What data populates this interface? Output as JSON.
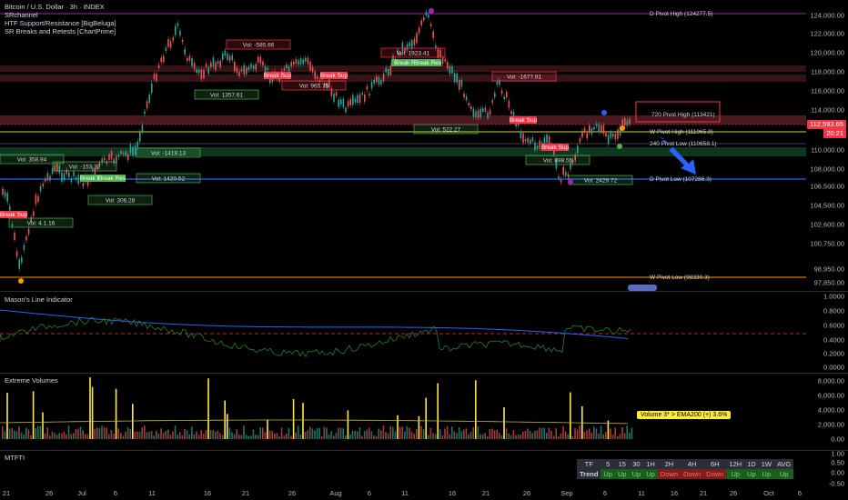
{
  "legend": {
    "title": "Bitcoin / U.S. Dollar · 3h · INDEX",
    "ind1": "SRchannel",
    "ind2": "HTF Support/Resistance [BigBeluga]",
    "ind3": "SR Breaks and Retests [ChartPrime]"
  },
  "price_axis": [
    "124,000.00",
    "122,000.00",
    "120,000.00",
    "118,000.00",
    "116,000.00",
    "114,000.00",
    "110,000.00",
    "108,000.00",
    "106,500.00",
    "104,500.00",
    "102,600.00",
    "100,750.00",
    "98,950.00",
    "97,850.00"
  ],
  "current_price": "112,593.65",
  "countdown": "20:21",
  "price_badge_color": "#f23645",
  "pivots": {
    "d_high": "D Pivot High (124277.5)",
    "p720_high": "720 Pivot High (113421)",
    "w_high": "W Pivot High (111965.8)",
    "p240_low": "240 Pivot Low (110658.1)",
    "d_low": "D Pivot Low (107286.3)",
    "w_low": "W Pivot Low (98330.3)"
  },
  "vol_labels": [
    "Vol: -585.66",
    "Vol: 1923.41",
    "Vol: -1677.91",
    "Vol: 1357.61",
    "Vol: 965.75",
    "Vol: 522.27",
    "Vol: -1419.13",
    "Vol: 358.94",
    "Vol: -153.22",
    "Vol: 1420.52",
    "Vol: 306.28",
    "Vol: 4.1.16",
    "Vol: 898.55",
    "Vol: 2429.72"
  ],
  "break_labels": [
    "Break Sup",
    "Break R",
    "Break Res",
    "Break Sup",
    "Break Sup",
    "Break Sup",
    "Break Res",
    "Break Res",
    "Break Sup"
  ],
  "mason": {
    "title": "Mason's Line Indicator",
    "axis": [
      "1.0000",
      "0.8000",
      "0.6000",
      "0.4000",
      "0.2000",
      "0.0000"
    ]
  },
  "volume": {
    "title": "Extreme Volumes",
    "axis": [
      "8,000.00",
      "6,000.00",
      "4,000.00",
      "2,000.00",
      "0.00"
    ],
    "note": "Volume 3* > EMA200 (+) 3.6%"
  },
  "mtfti": {
    "title": "MTFTI",
    "axis": [
      "1.00",
      "0.50",
      "0.00",
      "-0.50"
    ],
    "headers": [
      "TF",
      "5",
      "15",
      "30",
      "1H",
      "2H",
      "4H",
      "6H",
      "12H",
      "1D",
      "1W",
      "AVG"
    ],
    "row_label": "Trend",
    "values": [
      "Up",
      "Up",
      "Up",
      "Up",
      "Down",
      "Down",
      "Down",
      "Up",
      "Up",
      "Up",
      "Up"
    ]
  },
  "x_axis": [
    "21",
    "26",
    "Jul",
    "6",
    "11",
    "16",
    "21",
    "26",
    "Aug",
    "6",
    "11",
    "16",
    "21",
    "26",
    "Sep",
    "6",
    "11",
    "16",
    "21",
    "26",
    "Oct",
    "6"
  ]
}
